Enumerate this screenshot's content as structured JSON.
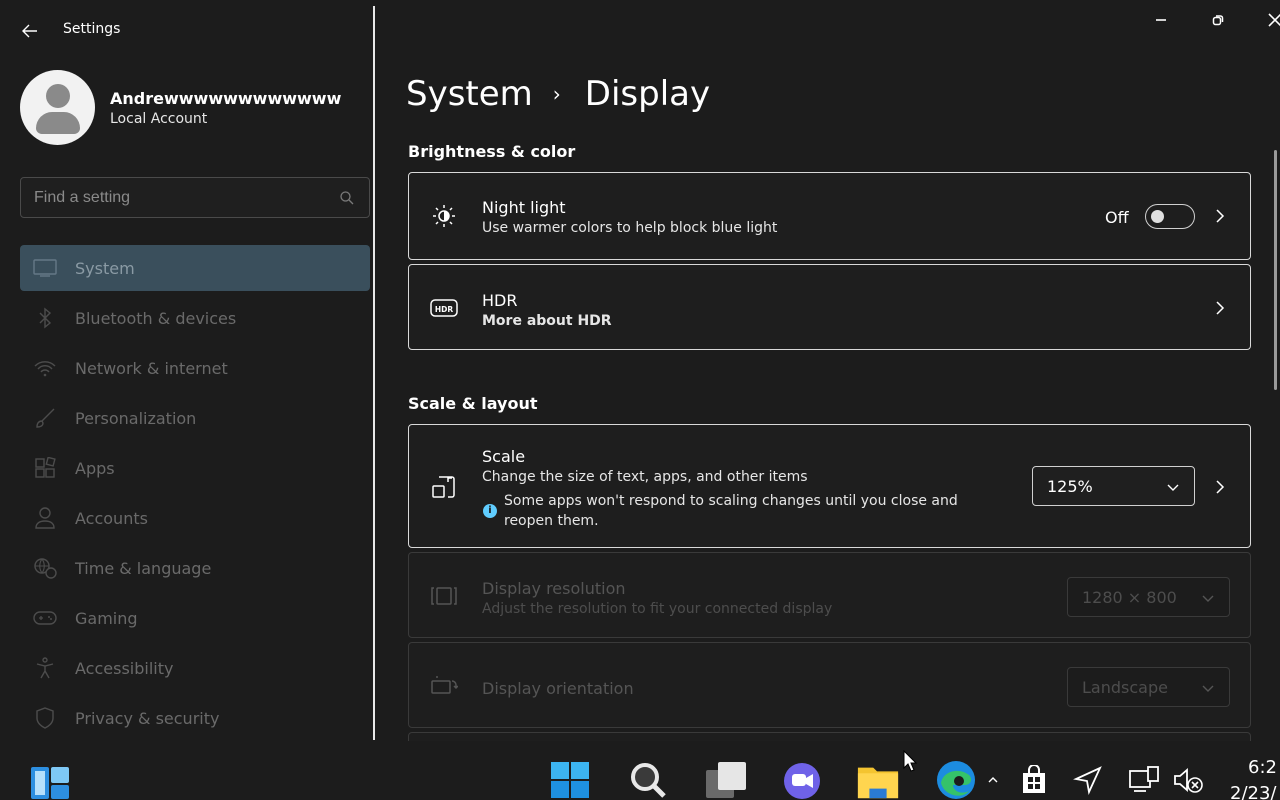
{
  "app": {
    "title": "Settings"
  },
  "profile": {
    "name": "Andrewwwwwwwwwwww",
    "account_type": "Local Account"
  },
  "search": {
    "placeholder": "Find a setting"
  },
  "sidebar": {
    "items": [
      {
        "label": "System",
        "icon": "monitor-icon",
        "selected": true
      },
      {
        "label": "Bluetooth & devices",
        "icon": "bluetooth-icon"
      },
      {
        "label": "Network & internet",
        "icon": "wifi-icon"
      },
      {
        "label": "Personalization",
        "icon": "brush-icon"
      },
      {
        "label": "Apps",
        "icon": "apps-icon"
      },
      {
        "label": "Accounts",
        "icon": "person-icon"
      },
      {
        "label": "Time & language",
        "icon": "globe-clock-icon"
      },
      {
        "label": "Gaming",
        "icon": "gamepad-icon"
      },
      {
        "label": "Accessibility",
        "icon": "accessibility-icon"
      },
      {
        "label": "Privacy & security",
        "icon": "shield-icon"
      }
    ]
  },
  "breadcrumb": {
    "parent": "System",
    "separator": "›",
    "current": "Display"
  },
  "sections": {
    "brightness": {
      "title": "Brightness & color"
    },
    "scale_layout": {
      "title": "Scale & layout"
    }
  },
  "night_light": {
    "title": "Night light",
    "subtitle": "Use warmer colors to help block blue light",
    "state_label": "Off",
    "enabled": false
  },
  "hdr": {
    "title": "HDR",
    "link": "More about HDR"
  },
  "scale": {
    "title": "Scale",
    "subtitle": "Change the size of text, apps, and other items",
    "info": "Some apps won't respond to scaling changes until you close and reopen them.",
    "value": "125%"
  },
  "resolution": {
    "title": "Display resolution",
    "subtitle": "Adjust the resolution to fit your connected display",
    "value": "1280 × 800"
  },
  "orientation": {
    "title": "Display orientation",
    "value": "Landscape"
  },
  "tray": {
    "time": "6:2",
    "date": "2/23/"
  },
  "colors": {
    "accent": "#60cdff",
    "selected_nav": "#3a4f5c",
    "background": "#1c1c1c"
  }
}
